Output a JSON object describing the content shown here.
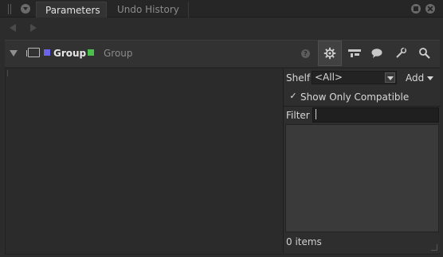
{
  "tabs": [
    {
      "label": "Parameters",
      "active": true
    },
    {
      "label": "Undo History",
      "active": false
    }
  ],
  "node": {
    "name": "Group",
    "class_label": "Group",
    "help_glyph": "?"
  },
  "toolbar": {
    "buttons": [
      {
        "icon": "gear-icon",
        "active": true
      },
      {
        "icon": "layout-icon",
        "active": false
      },
      {
        "icon": "comment-icon",
        "active": false
      },
      {
        "icon": "wrench-icon",
        "active": false
      },
      {
        "icon": "search-icon",
        "active": false
      }
    ]
  },
  "panel": {
    "shelf_label": "Shelf",
    "shelf_value": "<All>",
    "add_label": "Add",
    "show_only_compatible_label": "Show Only Compatible",
    "show_only_compatible_checked": true,
    "check_glyph": "✓",
    "filter_label": "Filter",
    "filter_value": "",
    "items_count": "0 items"
  },
  "colors": {
    "node_blue": "#6b64e8",
    "node_green": "#4bbf4b"
  }
}
